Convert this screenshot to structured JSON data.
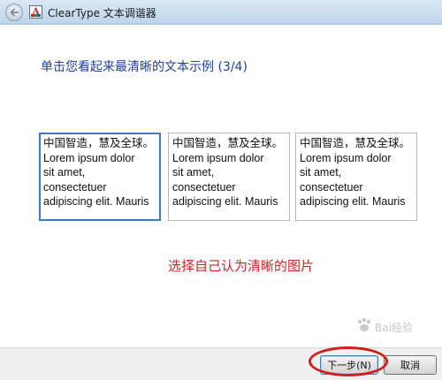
{
  "window": {
    "title": "ClearType 文本调谐器",
    "app_icon_letter": "A"
  },
  "wizard": {
    "heading": "单击您看起来最清晰的文本示例 (3/4)",
    "selected_index": 0,
    "samples": [
      {
        "text": "中国智造，慧及全球。\nLorem ipsum dolor\nsit amet,\nconsectetuer\nadipiscing elit. Mauris"
      },
      {
        "text": "中国智造，慧及全球。\nLorem ipsum dolor\nsit amet,\nconsectetuer\nadipiscing elit. Mauris"
      },
      {
        "text": "中国智造，慧及全球。\nLorem ipsum dolor\nsit amet,\nconsectetuer\nadipiscing elit. Mauris"
      }
    ]
  },
  "annotation": {
    "text": "选择自己认为清晰的图片",
    "color": "#d02323"
  },
  "footer": {
    "next_label": "下一步(N)",
    "cancel_label": "取消"
  },
  "watermark": {
    "text": "Bai经验"
  },
  "colors": {
    "heading": "#1e3fa0",
    "selection_border": "#3b7cc4",
    "highlight_oval": "#d11f1f"
  },
  "icons": {
    "back": "back-arrow-icon",
    "app": "cleartype-app-icon"
  }
}
